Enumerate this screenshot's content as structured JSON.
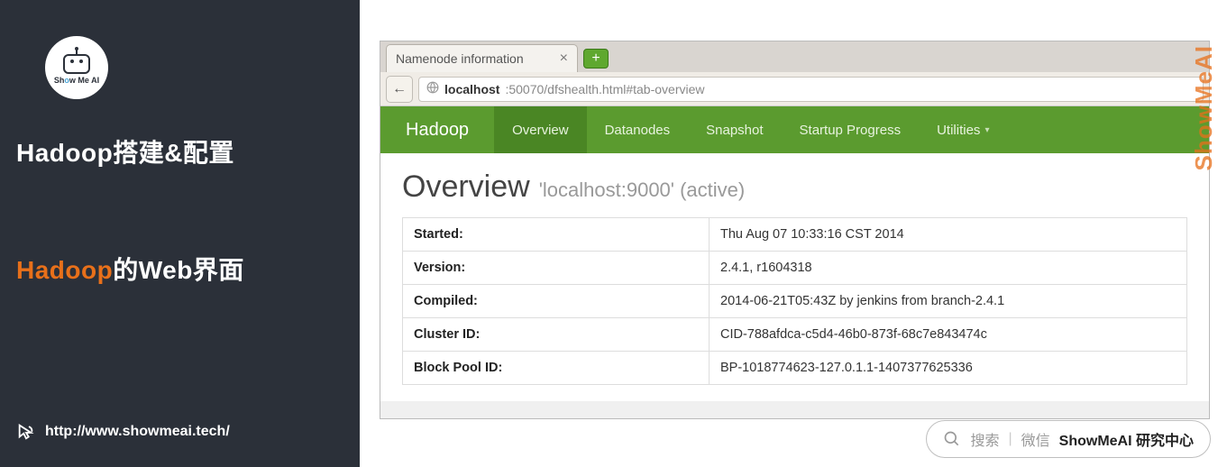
{
  "sidebar": {
    "logo_text_pre": "Sh",
    "logo_text_mid": "o",
    "logo_text_post": "w Me AI",
    "title_main": "Hadoop搭建&配置",
    "title_sub_orange": "Hadoop",
    "title_sub_white": "的Web界面",
    "footer_url": "http://www.showmeai.tech/"
  },
  "browser": {
    "tab_title": "Namenode information",
    "tab_close": "×",
    "tab_add": "+",
    "back_arrow": "←",
    "url_host": "localhost",
    "url_rest": ":50070/dfshealth.html#tab-overview"
  },
  "nav": {
    "brand": "Hadoop",
    "items": [
      "Overview",
      "Datanodes",
      "Snapshot",
      "Startup Progress",
      "Utilities"
    ]
  },
  "overview": {
    "heading": "Overview",
    "subheading": "'localhost:9000' (active)",
    "rows": [
      {
        "label": "Started:",
        "value": "Thu Aug 07 10:33:16 CST 2014"
      },
      {
        "label": "Version:",
        "value": "2.4.1, r1604318"
      },
      {
        "label": "Compiled:",
        "value": "2014-06-21T05:43Z by jenkins from branch-2.4.1"
      },
      {
        "label": "Cluster ID:",
        "value": "CID-788afdca-c5d4-46b0-873f-68c7e843474c"
      },
      {
        "label": "Block Pool ID:",
        "value": "BP-1018774623-127.0.1.1-1407377625336"
      }
    ]
  },
  "watermark": "ShowMeAI",
  "badge": {
    "t1a": "搜索",
    "t1b": "微信",
    "t2": "ShowMeAI 研究中心"
  }
}
